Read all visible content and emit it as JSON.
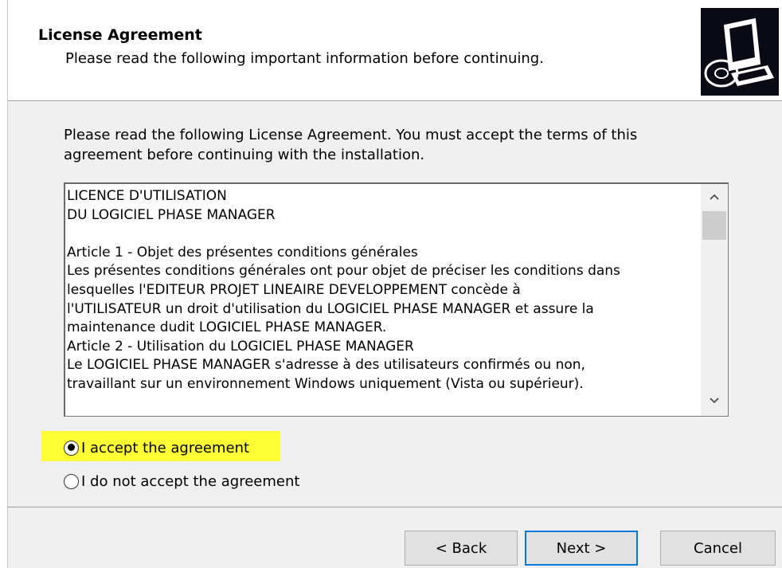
{
  "header": {
    "title": "License Agreement",
    "subtitle": "Please read the following important information before continuing."
  },
  "intro": {
    "text": "Please read the following License Agreement. You must accept the terms of this agreement before continuing with the installation."
  },
  "license_text": {
    "lines": [
      "LICENCE D'UTILISATION",
      "DU LOGICIEL PHASE MANAGER",
      "",
      "Article 1 - Objet des présentes conditions générales",
      "Les présentes conditions générales ont pour objet de préciser les conditions dans",
      "lesquelles l'EDITEUR PROJET LINEAIRE DEVELOPPEMENT concède à",
      "l'UTILISATEUR un droit d'utilisation du LOGICIEL PHASE MANAGER et assure la",
      "maintenance dudit LOGICIEL PHASE MANAGER.",
      "Article 2 - Utilisation du LOGICIEL PHASE MANAGER",
      "Le LOGICIEL PHASE MANAGER s'adresse à des utilisateurs confirmés ou non,",
      "travaillant sur un environnement Windows uniquement (Vista ou supérieur)."
    ]
  },
  "options": {
    "accept": {
      "label": "I accept the agreement",
      "checked": true
    },
    "decline": {
      "label": "I do not accept the agreement",
      "checked": false
    }
  },
  "buttons": {
    "back": "< Back",
    "next": "Next >",
    "cancel": "Cancel"
  },
  "icons": {
    "wizard": "setup-computer-icon",
    "scroll_up": "chevron-up-icon",
    "scroll_down": "chevron-down-icon"
  },
  "colors": {
    "accent": "#0078d7",
    "highlight": "#ffff33"
  }
}
